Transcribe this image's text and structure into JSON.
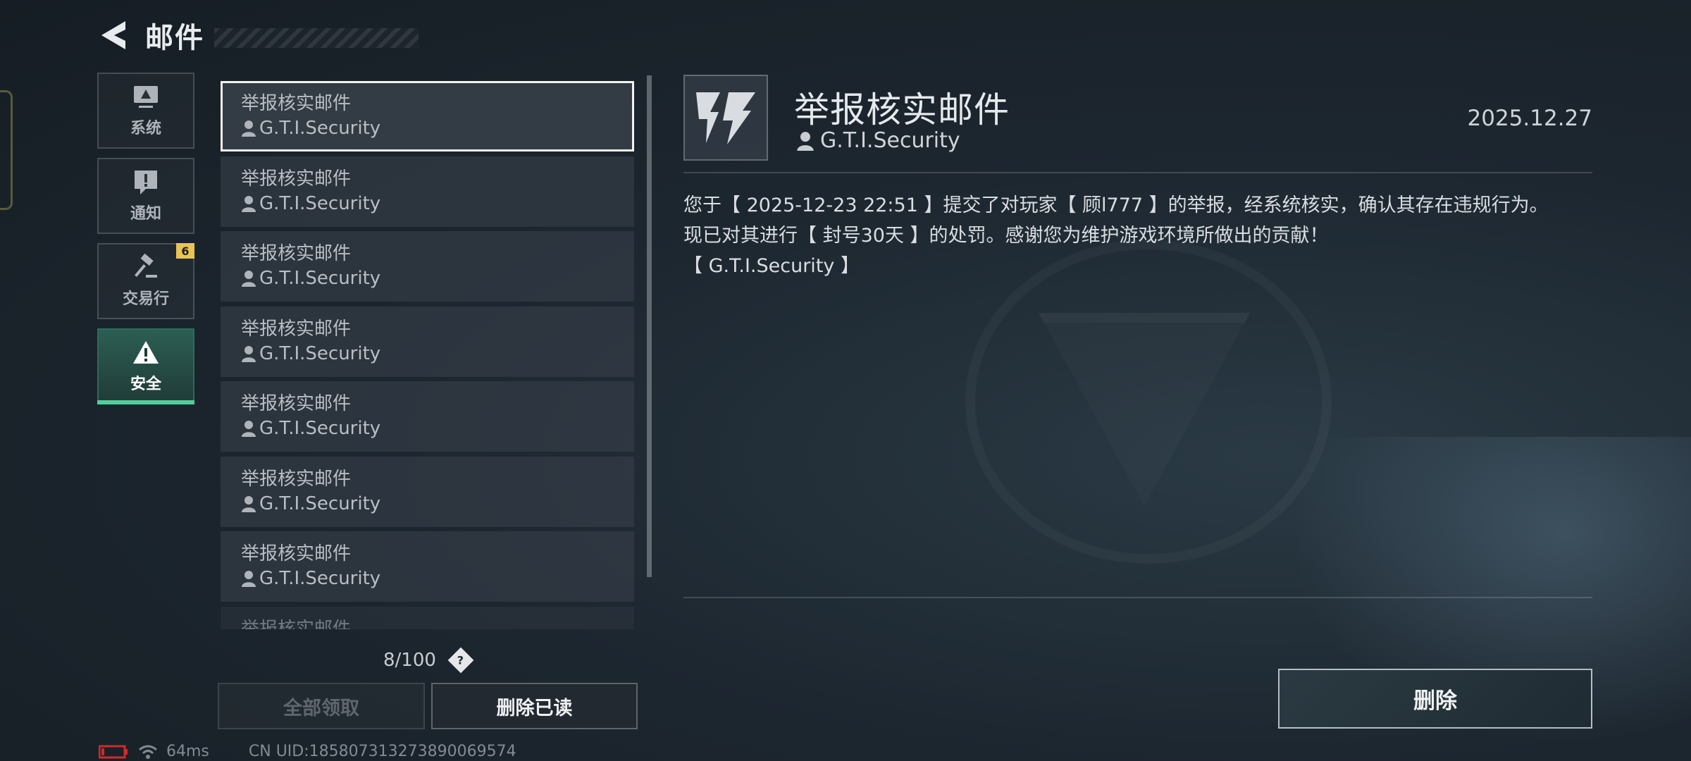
{
  "header": {
    "title": "邮件"
  },
  "sidebar": {
    "items": [
      {
        "label": "系统",
        "icon": "monitor-icon",
        "active": false
      },
      {
        "label": "通知",
        "icon": "notice-icon",
        "active": false
      },
      {
        "label": "交易行",
        "icon": "gavel-icon",
        "active": false,
        "badge": "6"
      },
      {
        "label": "安全",
        "icon": "warning-icon",
        "active": true
      }
    ]
  },
  "mail_list": {
    "items": [
      {
        "subject": "举报核实邮件",
        "sender": "G.T.I.Security",
        "selected": true
      },
      {
        "subject": "举报核实邮件",
        "sender": "G.T.I.Security"
      },
      {
        "subject": "举报核实邮件",
        "sender": "G.T.I.Security"
      },
      {
        "subject": "举报核实邮件",
        "sender": "G.T.I.Security"
      },
      {
        "subject": "举报核实邮件",
        "sender": "G.T.I.Security"
      },
      {
        "subject": "举报核实邮件",
        "sender": "G.T.I.Security"
      },
      {
        "subject": "举报核实邮件",
        "sender": "G.T.I.Security"
      },
      {
        "subject": "举报核实邮件",
        "sender": ""
      }
    ],
    "count": "8/100",
    "help": "?"
  },
  "actions": {
    "claim_all": "全部领取",
    "delete_read": "删除已读"
  },
  "detail": {
    "title": "举报核实邮件",
    "sender": "G.T.I.Security",
    "date": "2025.12.27",
    "body_line1": "您于【 2025-12-23 22:51 】提交了对玩家【 顾l777 】的举报，经系统核实，确认其存在违规行为。",
    "body_line2": "现已对其进行【 封号30天 】的处罚。感谢您为维护游戏环境所做出的贡献！",
    "body_line3": "【 G.T.I.Security 】",
    "delete": "删除"
  },
  "footer": {
    "ping": "64ms",
    "uid": "CN UID:185807313273890069574"
  },
  "colors": {
    "accent_green": "#4fcf9c",
    "badge_yellow": "#e8c552",
    "battery_red": "#d12a2a"
  }
}
